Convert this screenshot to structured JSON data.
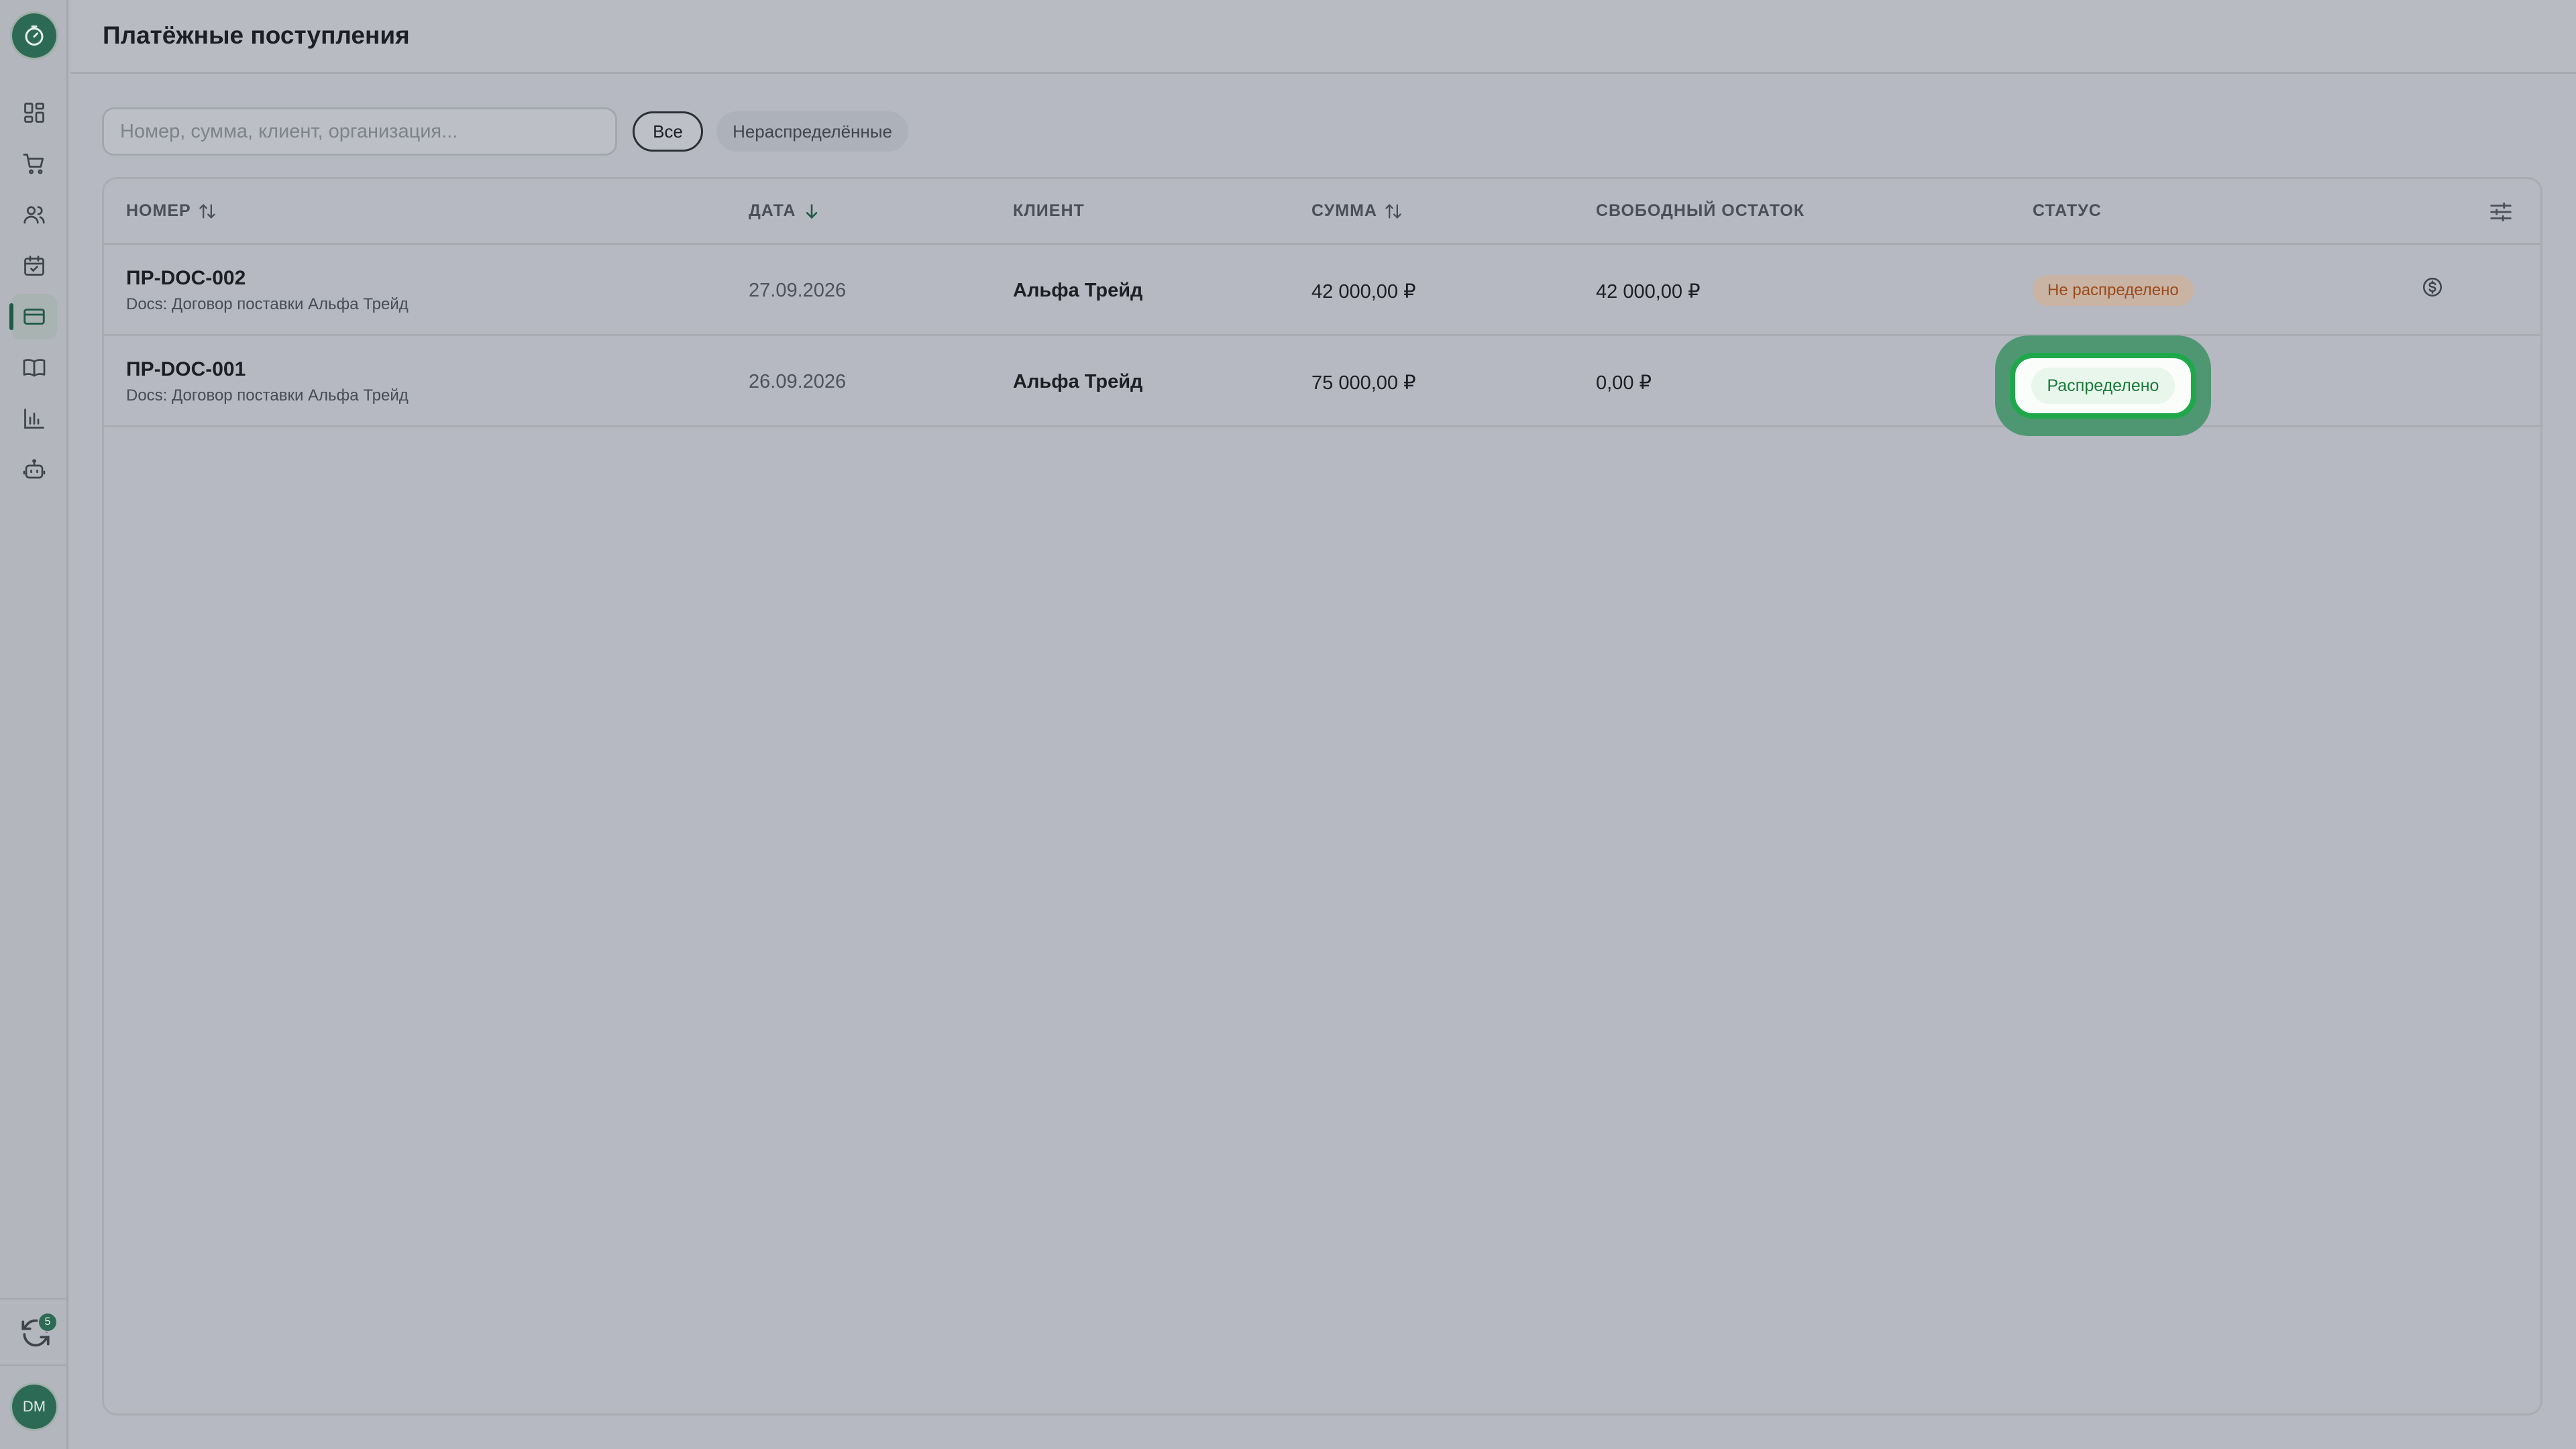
{
  "app": {
    "title": "Платёжные поступления",
    "accent": "#2d6a55"
  },
  "sidebar": {
    "items": [
      {
        "icon": "dashboard-icon"
      },
      {
        "icon": "cart-icon"
      },
      {
        "icon": "users-icon"
      },
      {
        "icon": "calendar-check-icon"
      },
      {
        "icon": "credit-card-icon",
        "active": true
      },
      {
        "icon": "book-icon"
      },
      {
        "icon": "bar-chart-icon"
      },
      {
        "icon": "robot-icon"
      }
    ],
    "sync_badge": "5",
    "avatar": "DM"
  },
  "toolbar": {
    "search_placeholder": "Номер, сумма, клиент, организация...",
    "filter_all": "Все",
    "filter_unallocated": "Нераспределённые"
  },
  "table": {
    "columns": {
      "number": "НОМЕР",
      "date": "ДАТА",
      "client": "КЛИЕНТ",
      "amount": "СУММА",
      "free_balance": "СВОБОДНЫЙ ОСТАТОК",
      "status": "СТАТУС"
    },
    "rows": [
      {
        "number": "ПР-DOC-002",
        "subtitle": "Docs: Договор поставки Альфа Трейд",
        "date": "27.09.2026",
        "client": "Альфа Трейд",
        "amount": "42 000,00 ₽",
        "free_balance": "42 000,00 ₽",
        "status": "Не распределено"
      },
      {
        "number": "ПР-DOC-001",
        "subtitle": "Docs: Договор поставки Альфа Трейд",
        "date": "26.09.2026",
        "client": "Альфа Трейд",
        "amount": "75 000,00 ₽",
        "free_balance": "0,00 ₽",
        "status": "Распределено"
      }
    ]
  }
}
